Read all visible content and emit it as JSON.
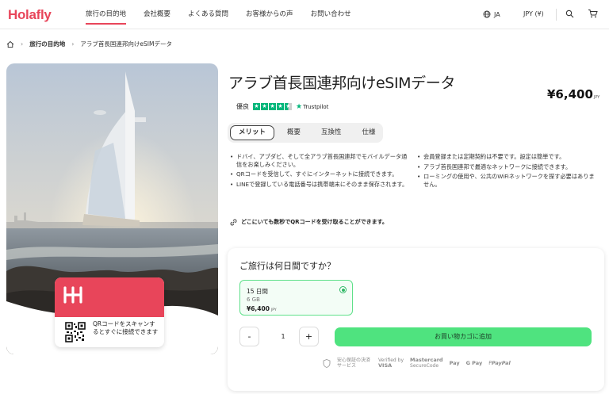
{
  "brand": {
    "logo_text": "Holafly",
    "accent": "#e8455a"
  },
  "nav": {
    "items": [
      {
        "label": "旅行の目的地",
        "active": true
      },
      {
        "label": "会社概要"
      },
      {
        "label": "よくある質問"
      },
      {
        "label": "お客様からの声"
      },
      {
        "label": "お問い合わせ"
      }
    ],
    "language": "JA",
    "currency": "JPY (¥)"
  },
  "breadcrumb": {
    "items": [
      "旅行の目的地",
      "アラブ首長国連邦向けeSIMデータ"
    ]
  },
  "product": {
    "title": "アラブ首長国連邦向けeSIMデータ",
    "price": "¥6,400",
    "price_unit": "JPY",
    "rating_label": "優良",
    "rating_stars": 4.5,
    "trustpilot": "Trustpilot"
  },
  "tabs": [
    "メリット",
    "概要",
    "互換性",
    "仕様"
  ],
  "benefits": {
    "left": [
      "ドバイ、アブダビ、そして全アラブ首長国連邦でモバイルデータ通信をお楽しみください。",
      "QRコードを受信して、すぐにインターネットに接続できます。",
      "LINEで登録している電話番号は携帯端末にそのまま保存されます。"
    ],
    "right": [
      "会員登録または定期契約は不要です。設定は簡単です。",
      "アラブ首長国連邦で最適なネットワークに接続できます。",
      "ローミングの使用や、公共のWiFiネットワークを探す必要はありません。"
    ],
    "qr_note": "どこにいても数秒でQRコードを受け取ることができます。"
  },
  "hero_card": {
    "text": "QRコードをスキャンするとすぐに接続できます"
  },
  "booking": {
    "question": "ご旅行は何日間ですか？",
    "plan": {
      "days": "15 日間",
      "data": "6 GB",
      "price": "¥6,400",
      "price_unit": "JPY"
    },
    "quantity": "1",
    "minus": "-",
    "plus": "+",
    "add_to_cart": "お買い物カゴに追加",
    "payments": {
      "secure": "安心保証の決済サービス",
      "verified_by": "Verified by",
      "visa": "VISA",
      "mastercard": "Mastercard",
      "securecode": "SecureCode",
      "applepay": "Pay",
      "gpay": "G Pay",
      "paypal": "PayPal"
    }
  },
  "colors": {
    "cta": "#4fe37f",
    "trustpilot": "#00b67a",
    "plan_border": "#5fe08a"
  }
}
